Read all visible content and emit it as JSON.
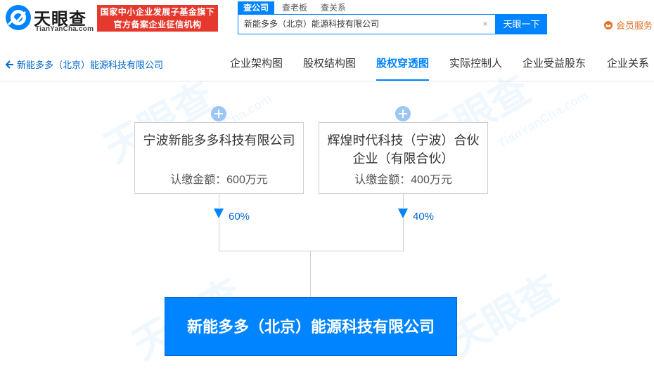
{
  "header": {
    "logo_cn": "天眼查",
    "logo_en": "TianYanCha.com",
    "banner_line1": "国家中小企业发展子基金旗下",
    "banner_line2": "官方备案企业征信机构",
    "search_tabs": [
      "查公司",
      "查老板",
      "查关系"
    ],
    "search_value": "新能多多（北京）能源科技有限公司",
    "search_button": "天眼一下",
    "member_label": "会员服务",
    "accent_color": "#0084ff",
    "banner_color": "#e6392d"
  },
  "navbar": {
    "back_label": "新能多多（北京）能源科技有限公司",
    "tabs": [
      "企业架构图",
      "股权结构图",
      "股权穿透图",
      "实际控制人",
      "企业受益股东",
      "企业关系"
    ],
    "active_tab": "股权穿透图"
  },
  "watermark": {
    "cn": "天眼查",
    "en": "TianYanCha.com"
  },
  "diagram": {
    "shareholders": [
      {
        "name": "宁波新能多多科技有限公司",
        "amount": "认缴金额：600万元",
        "percent": "60%"
      },
      {
        "name": "辉煌时代科技（宁波）合伙企业（有限合伙）",
        "amount": "认缴金额：400万元",
        "percent": "40%"
      }
    ],
    "target_company": "新能多多（北京）能源科技有限公司"
  }
}
